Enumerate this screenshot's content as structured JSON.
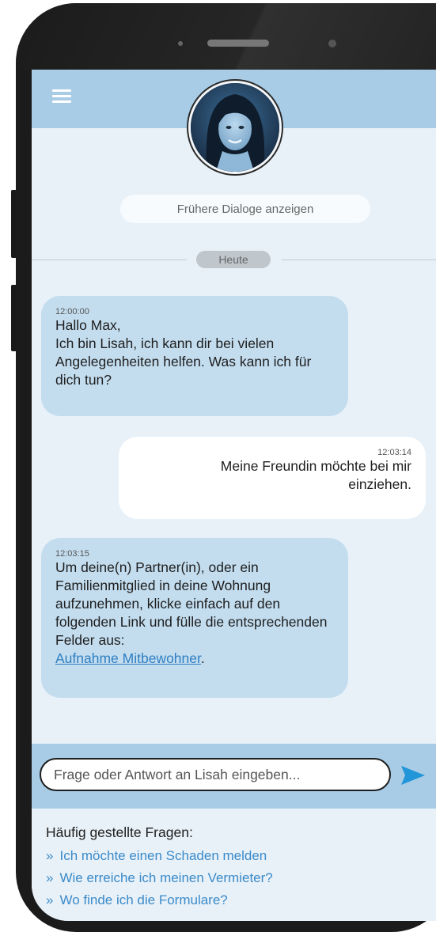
{
  "header": {
    "menu_icon": "hamburger-menu-icon",
    "avatar_alt": "Lisah"
  },
  "history_button": "Frühere Dialoge anzeigen",
  "date_divider": "Heute",
  "messages": [
    {
      "sender": "bot",
      "time": "12:00:00",
      "text": "Hallo Max,\nIch bin Lisah, ich kann dir bei vielen Angelegenheiten helfen. Was kann ich für dich tun?"
    },
    {
      "sender": "user",
      "time": "12:03:14",
      "text": "Meine Freundin möchte bei mir einziehen."
    },
    {
      "sender": "bot",
      "time": "12:03:15",
      "text": "Um deine(n) Partner(in), oder ein Familienmitglied in deine Wohnung aufzunehmen, klicke einfach auf den folgenden Link und fülle die entsprechenden Felder aus:",
      "link": "Aufnahme Mitbewohner",
      "link_suffix": "."
    }
  ],
  "input": {
    "placeholder": "Frage oder Antwort an Lisah eingeben...",
    "send_icon": "send-arrow-icon"
  },
  "faq": {
    "title": "Häufig gestellte Fragen:",
    "bullet": "»",
    "items": [
      "Ich möchte einen Schaden melden",
      "Wie erreiche ich meinen Vermieter?",
      "Wo finde ich die Formulare?"
    ]
  },
  "colors": {
    "header_bg": "#a8cce6",
    "screen_bg": "#e8f1f8",
    "bot_bubble": "#c3ddef",
    "user_bubble": "#ffffff",
    "link": "#2f7fc2",
    "faq_link": "#3b8ac9",
    "send_icon": "#2196d8"
  }
}
